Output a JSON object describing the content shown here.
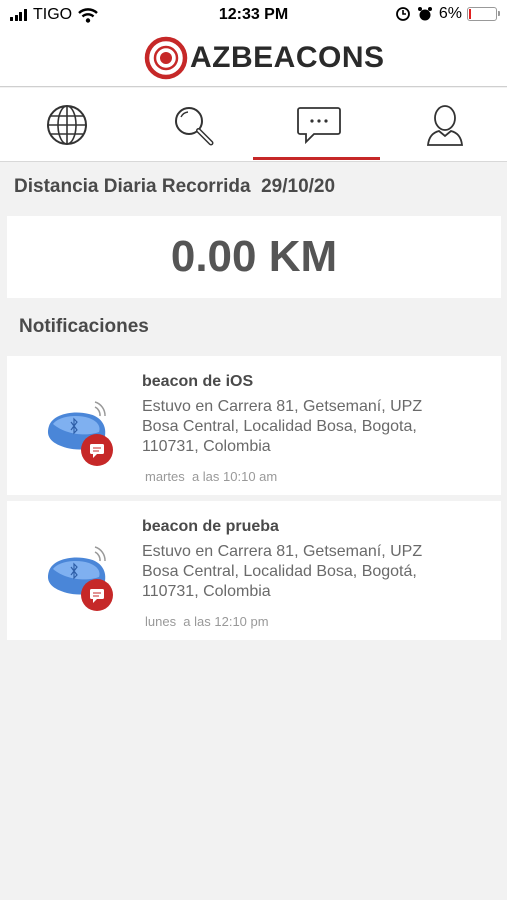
{
  "status_bar": {
    "carrier": "TIGO",
    "time": "12:33 PM",
    "battery": "6%",
    "battery_level": 0.06
  },
  "header": {
    "logo_text": "AZBEACONS"
  },
  "tabs": [
    {
      "name": "globe-icon",
      "selected": false
    },
    {
      "name": "search-icon",
      "selected": false
    },
    {
      "name": "chat-icon",
      "selected": true
    },
    {
      "name": "user-icon",
      "selected": false
    }
  ],
  "distance": {
    "title": "Distancia Diaria Recorrida  29/10/20",
    "value": "0.00 KM"
  },
  "notifications": {
    "heading": "Notificaciones",
    "items": [
      {
        "title": "beacon de iOS",
        "body": "Estuvo en Carrera 81, Getsemaní, UPZ Bosa Central, Localidad Bosa, Bogota, 110731, Colombia",
        "time": "martes  a las 10:10 am"
      },
      {
        "title": "beacon de prueba",
        "body": "Estuvo en Carrera 81, Getsemaní, UPZ Bosa Central, Localidad Bosa, Bogotá, 110731, Colombia",
        "time": "lunes  a las 12:10 pm"
      }
    ]
  },
  "colors": {
    "accent": "#c62828",
    "beacon_blue": "#4a86d8",
    "background": "#f2f2f2"
  }
}
